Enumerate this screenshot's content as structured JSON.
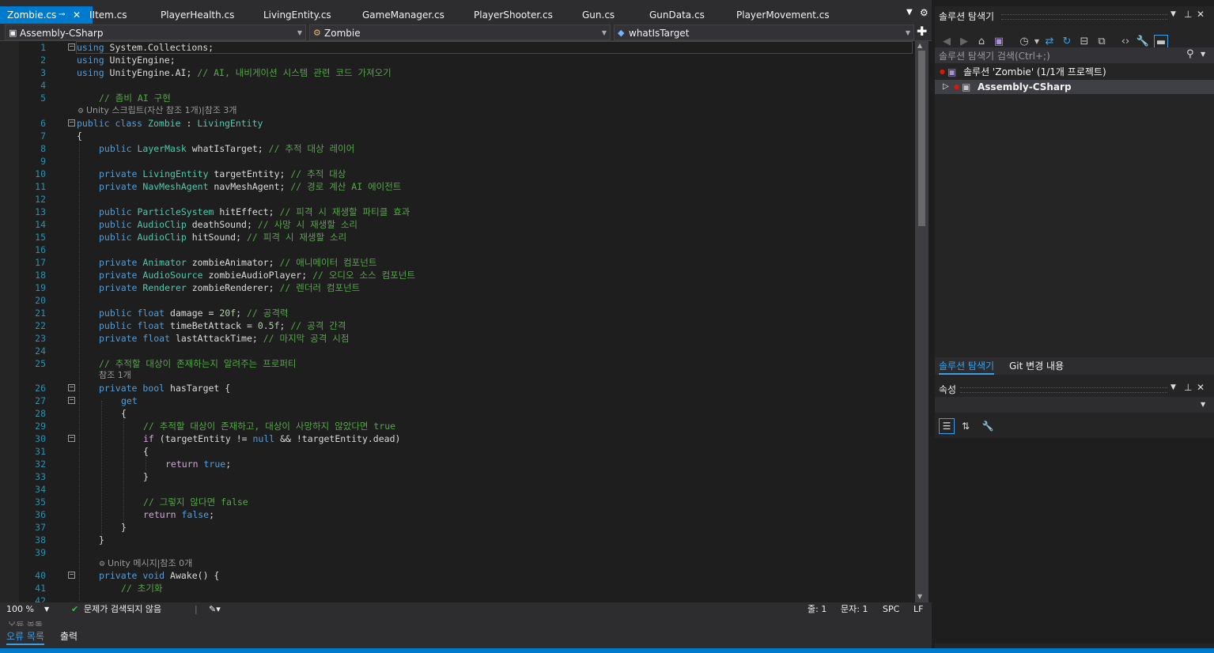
{
  "tabs": [
    {
      "label": "Zombie.cs",
      "active": true
    },
    {
      "label": "IItem.cs"
    },
    {
      "label": "PlayerHealth.cs"
    },
    {
      "label": "LivingEntity.cs"
    },
    {
      "label": "GameManager.cs"
    },
    {
      "label": "PlayerShooter.cs"
    },
    {
      "label": "Gun.cs"
    },
    {
      "label": "GunData.cs"
    },
    {
      "label": "PlayerMovement.cs"
    }
  ],
  "navbar": {
    "project": "Assembly-CSharp",
    "type": "Zombie",
    "member": "whatIsTarget"
  },
  "code": {
    "line_numbers": [
      "1",
      "2",
      "3",
      "4",
      "5",
      "6",
      "7",
      "8",
      "9",
      "10",
      "11",
      "12",
      "13",
      "14",
      "15",
      "16",
      "17",
      "18",
      "19",
      "20",
      "21",
      "22",
      "23",
      "24",
      "25",
      "26",
      "27",
      "28",
      "29",
      "30",
      "31",
      "32",
      "33",
      "34",
      "35",
      "36",
      "37",
      "38",
      "39",
      "40",
      "41",
      "42"
    ],
    "lens_1": "Unity 스크립트(자산 참조 1개)|참조 3개",
    "lens_2": "참조 1개",
    "lens_3": "Unity 메시지|참조 0개",
    "l1": [
      "using",
      " System.Collections;"
    ],
    "l2": [
      "using",
      " UnityEngine;"
    ],
    "l3": [
      "using",
      " UnityEngine.AI; ",
      "// AI, 내비게이션 시스템 관련 코드 가져오기"
    ],
    "l5": "// 좀비 AI 구현",
    "l6": [
      "public",
      " ",
      "class",
      " ",
      "Zombie",
      " : ",
      "LivingEntity"
    ],
    "l7": "{",
    "l8": [
      "public",
      " ",
      "LayerMask",
      " whatIsTarget; ",
      "// 추적 대상 레이어"
    ],
    "l10": [
      "private",
      " ",
      "LivingEntity",
      " targetEntity; ",
      "// 추적 대상"
    ],
    "l11": [
      "private",
      " ",
      "NavMeshAgent",
      " navMeshAgent; ",
      "// 경로 계산 AI 에이전트"
    ],
    "l13": [
      "public",
      " ",
      "ParticleSystem",
      " hitEffect; ",
      "// 피격 시 재생할 파티클 효과"
    ],
    "l14": [
      "public",
      " ",
      "AudioClip",
      " deathSound; ",
      "// 사망 시 재생할 소리"
    ],
    "l15": [
      "public",
      " ",
      "AudioClip",
      " hitSound; ",
      "// 피격 시 재생할 소리"
    ],
    "l17": [
      "private",
      " ",
      "Animator",
      " zombieAnimator; ",
      "// 애니메이터 컴포넌트"
    ],
    "l18": [
      "private",
      " ",
      "AudioSource",
      " zombieAudioPlayer; ",
      "// 오디오 소스 컴포넌트"
    ],
    "l19": [
      "private",
      " ",
      "Renderer",
      " zombieRenderer; ",
      "// 렌더러 컴포넌트"
    ],
    "l21": [
      "public",
      " ",
      "float",
      " damage = ",
      "20f",
      "; ",
      "// 공격력"
    ],
    "l22": [
      "public",
      " ",
      "float",
      " timeBetAttack = ",
      "0.5f",
      "; ",
      "// 공격 간격"
    ],
    "l23": [
      "private",
      " ",
      "float",
      " lastAttackTime; ",
      "// 마지막 공격 시점"
    ],
    "l25": "// 추적할 대상이 존재하는지 알려주는 프로퍼티",
    "l26": [
      "private",
      " ",
      "bool",
      " hasTarget {"
    ],
    "l27": "get",
    "l28": "{",
    "l29": "// 추적할 대상이 존재하고, 대상이 사망하지 않았다면 true",
    "l30": [
      "if",
      " (targetEntity != ",
      "null",
      " && !targetEntity.dead)"
    ],
    "l31": "{",
    "l32": [
      "return",
      " ",
      "true",
      ";"
    ],
    "l33": "}",
    "l35": "// 그렇지 않다면 false",
    "l36": [
      "return",
      " ",
      "false",
      ";"
    ],
    "l37": "}",
    "l38": "}",
    "l40": [
      "private",
      " ",
      "void",
      " Awake() {"
    ],
    "l41": "// 초기화"
  },
  "editor_status": {
    "zoom": "100 %",
    "issues": "문제가 검색되지 않음",
    "line": "줄: 1",
    "col": "문자: 1",
    "spc": "SPC",
    "lf": "LF"
  },
  "bottom_tabs": {
    "errors": "오류 목록",
    "output": "출력",
    "hidden_title": "오류 목록"
  },
  "solution_explorer": {
    "title": "솔루션 탐색기",
    "search_placeholder": "솔루션 탐색기 검색(Ctrl+;)",
    "solution": "솔루션 'Zombie' (1/1개 프로젝트)",
    "project": "Assembly-CSharp",
    "tab_solution": "솔루션 탐색기",
    "tab_git": "Git 변경 내용"
  },
  "properties": {
    "title": "속성"
  },
  "colors": {
    "accent": "#007acc",
    "keyword": "#569cd6",
    "type": "#4ec9b0",
    "comment": "#57a64a",
    "number": "#b5cea8",
    "control": "#d8a0df"
  }
}
